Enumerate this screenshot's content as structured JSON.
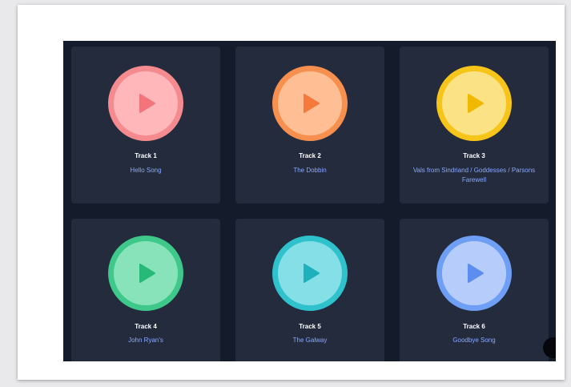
{
  "tracks": [
    {
      "title": "Track 1",
      "name": "Hello Song",
      "ring_color": "#f58a8f",
      "fill_color": "#ffb7ba",
      "icon_color": "#f4747c",
      "icon": "play-icon"
    },
    {
      "title": "Track 2",
      "name": "The Dobbin",
      "ring_color": "#f7904f",
      "fill_color": "#ffbe94",
      "icon_color": "#f5793a",
      "icon": "play-icon"
    },
    {
      "title": "Track 3",
      "name": "Vals from Sindriand / Goddesses / Parsons Farewell",
      "ring_color": "#f7c519",
      "fill_color": "#fbe284",
      "icon_color": "#f1b800",
      "icon": "play-icon"
    },
    {
      "title": "Track 4",
      "name": "John Ryan's",
      "ring_color": "#3ec98a",
      "fill_color": "#88e3ba",
      "icon_color": "#28b877",
      "icon": "play-icon"
    },
    {
      "title": "Track 5",
      "name": "The Galway",
      "ring_color": "#2fc2cc",
      "fill_color": "#84dfe6",
      "icon_color": "#1eb0bb",
      "icon": "play-icon"
    },
    {
      "title": "Track 6",
      "name": "Goodbye Song",
      "ring_color": "#6f9ff5",
      "fill_color": "#b6cdfb",
      "icon_color": "#5b8ef0",
      "icon": "play-icon"
    }
  ],
  "colors": {
    "panel_background": "#141c2b",
    "card_background": "#232b3d",
    "title_text": "#ffffff",
    "link_text": "#8aa8ff"
  }
}
